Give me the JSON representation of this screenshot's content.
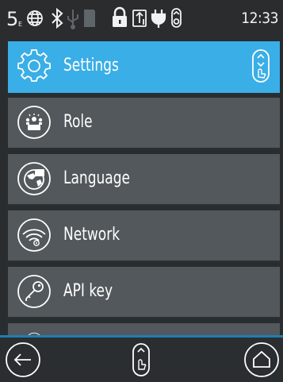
{
  "status_bar": {
    "network_label": "5",
    "network_sublabel": "E",
    "time": "12:33",
    "icons": [
      "globe-icon",
      "bluetooth-icon",
      "usb-icon",
      "sd-card-icon",
      "lock-icon",
      "sync-icon",
      "power-plug-icon",
      "touch-icon"
    ]
  },
  "menu": {
    "items": [
      {
        "label": "Settings",
        "icon": "gear-icon",
        "selected": true
      },
      {
        "label": "Role",
        "icon": "role-icon",
        "selected": false
      },
      {
        "label": "Language",
        "icon": "globe-icon",
        "selected": false
      },
      {
        "label": "Network",
        "icon": "wifi-icon",
        "selected": false
      },
      {
        "label": "API key",
        "icon": "key-icon",
        "selected": false
      }
    ]
  },
  "bottom_bar": {
    "buttons": [
      "back-icon",
      "scroll-touch-icon",
      "home-icon"
    ]
  },
  "colors": {
    "accent": "#3aaee6",
    "item_bg": "#52585c",
    "background": "#2b2e30",
    "bar_line": "#1e7fb4"
  }
}
